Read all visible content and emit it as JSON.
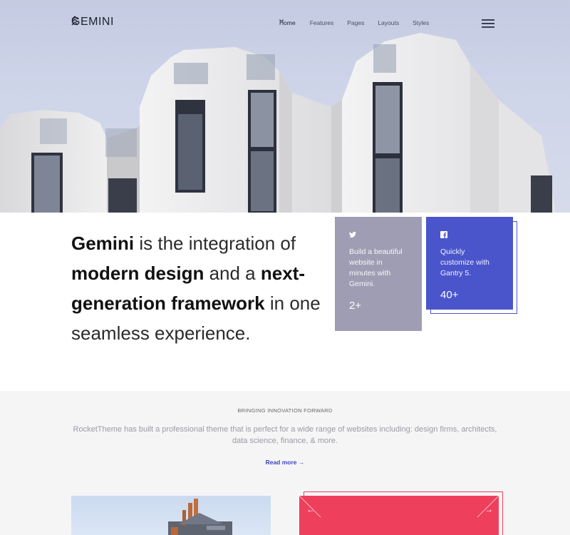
{
  "brand": {
    "name": "GEMINI"
  },
  "nav": {
    "items": [
      {
        "label": "Home"
      },
      {
        "label": "Features"
      },
      {
        "label": "Pages"
      },
      {
        "label": "Layouts"
      },
      {
        "label": "Styles"
      }
    ]
  },
  "intro": {
    "seg1": "Gemini",
    "seg2": " is the integration of ",
    "seg3": "modern design",
    "seg4": " and a ",
    "seg5": "next-generation framework",
    "seg6": " in one seamless experience."
  },
  "cards": {
    "twitter": {
      "icon": "twitter-icon",
      "text": "Build a beautiful website in minutes with Gemini.",
      "count": "2+",
      "color": "#9e9db3"
    },
    "facebook": {
      "icon": "facebook-icon",
      "text": "Quickly customize with Gantry 5.",
      "count": "40+",
      "color": "#4a55cc"
    }
  },
  "section2": {
    "eyebrow": "BRINGING INNOVATION FORWARD",
    "description": "RocketTheme has built a professional theme that is perfect for a wide range of websites including: design firms, architects, data science, finance, & more.",
    "read_more": "Read more →"
  },
  "slider": {
    "prev": "←",
    "next": "→",
    "color": "#ee3f5c"
  },
  "colors": {
    "accent": "#4a55cc",
    "accent_link": "#3d44c4",
    "pink": "#ee3f5c"
  }
}
